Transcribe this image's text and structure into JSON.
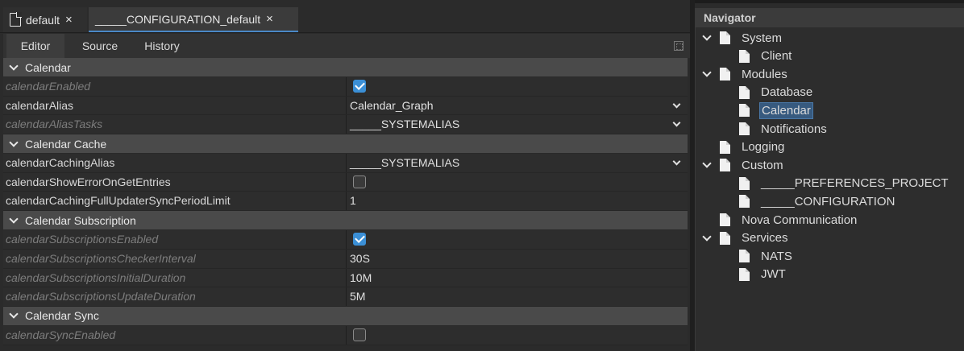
{
  "tabs": [
    {
      "label": "default",
      "close": "×"
    },
    {
      "label": "_____CONFIGURATION_default",
      "close": "×"
    }
  ],
  "subtabs": [
    "Editor",
    "Source",
    "History"
  ],
  "sections": [
    {
      "title": "Calendar",
      "rows": [
        {
          "name": "calendarEnabled",
          "inherited": true,
          "type": "checkbox",
          "checked": true
        },
        {
          "name": "calendarAlias",
          "inherited": false,
          "type": "select",
          "value": "Calendar_Graph"
        },
        {
          "name": "calendarAliasTasks",
          "inherited": true,
          "type": "select",
          "value": "_____SYSTEMALIAS"
        }
      ]
    },
    {
      "title": "Calendar Cache",
      "rows": [
        {
          "name": "calendarCachingAlias",
          "inherited": false,
          "type": "select",
          "value": "_____SYSTEMALIAS"
        },
        {
          "name": "calendarShowErrorOnGetEntries",
          "inherited": false,
          "type": "checkbox",
          "checked": false
        },
        {
          "name": "calendarCachingFullUpdaterSyncPeriodLimit",
          "inherited": false,
          "type": "text",
          "value": "1"
        }
      ]
    },
    {
      "title": "Calendar Subscription",
      "rows": [
        {
          "name": "calendarSubscriptionsEnabled",
          "inherited": true,
          "type": "checkbox",
          "checked": true
        },
        {
          "name": "calendarSubscriptionsCheckerInterval",
          "inherited": true,
          "type": "text",
          "value": "30S"
        },
        {
          "name": "calendarSubscriptionsInitialDuration",
          "inherited": true,
          "type": "text",
          "value": "10M"
        },
        {
          "name": "calendarSubscriptionsUpdateDuration",
          "inherited": true,
          "type": "text",
          "value": "5M"
        }
      ]
    },
    {
      "title": "Calendar Sync",
      "rows": [
        {
          "name": "calendarSyncEnabled",
          "inherited": true,
          "type": "checkbox",
          "checked": false
        }
      ]
    }
  ],
  "navigator": {
    "title": "Navigator",
    "nodes": [
      {
        "label": "System",
        "depth": 0,
        "expanded": true,
        "selected": false
      },
      {
        "label": "Client",
        "depth": 1,
        "expanded": false,
        "selected": false
      },
      {
        "label": "Modules",
        "depth": 0,
        "expanded": true,
        "selected": false
      },
      {
        "label": "Database",
        "depth": 1,
        "expanded": false,
        "selected": false
      },
      {
        "label": "Calendar",
        "depth": 1,
        "expanded": false,
        "selected": true
      },
      {
        "label": "Notifications",
        "depth": 1,
        "expanded": false,
        "selected": false
      },
      {
        "label": "Logging",
        "depth": 0,
        "expanded": false,
        "selected": false
      },
      {
        "label": "Custom",
        "depth": 0,
        "expanded": true,
        "selected": false
      },
      {
        "label": "_____PREFERENCES_PROJECT",
        "depth": 1,
        "expanded": false,
        "selected": false
      },
      {
        "label": "_____CONFIGURATION",
        "depth": 1,
        "expanded": false,
        "selected": false
      },
      {
        "label": "Nova Communication",
        "depth": 0,
        "expanded": false,
        "selected": false
      },
      {
        "label": "Services",
        "depth": 0,
        "expanded": true,
        "selected": false
      },
      {
        "label": "NATS",
        "depth": 1,
        "expanded": false,
        "selected": false
      },
      {
        "label": "JWT",
        "depth": 1,
        "expanded": false,
        "selected": false
      }
    ]
  },
  "colors": {
    "accent": "#3b8fd6",
    "selection": "#375a7f"
  }
}
